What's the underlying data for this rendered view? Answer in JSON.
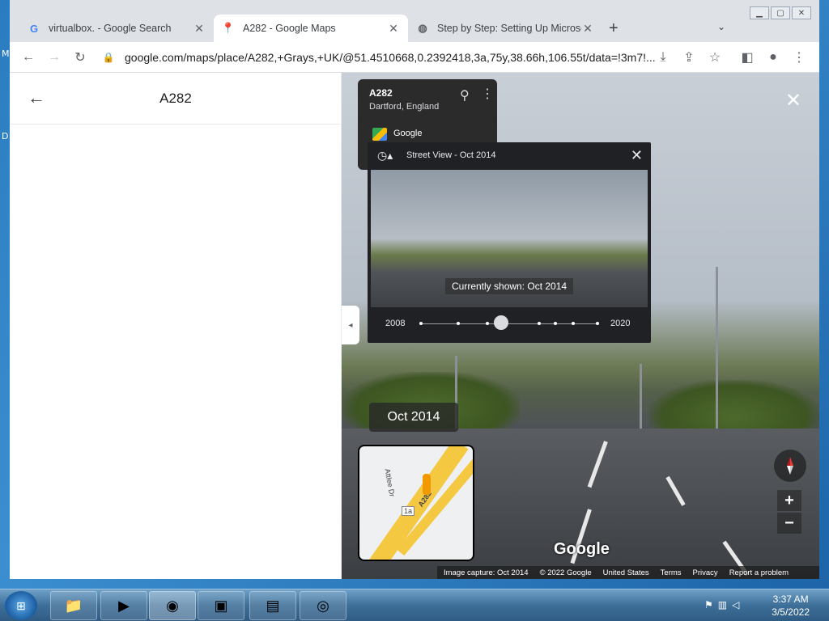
{
  "desktop": {
    "left_letters": [
      "M",
      "D"
    ]
  },
  "browser": {
    "tabs": [
      {
        "title": "virtualbox. - Google Search",
        "icon": "google-g-icon",
        "active": false
      },
      {
        "title": "A282 - Google Maps",
        "icon": "maps-pin-icon",
        "active": true
      },
      {
        "title": "Step by Step: Setting Up Microsoft",
        "icon": "globe-icon",
        "active": false
      }
    ],
    "new_tab_label": "+",
    "url": "google.com/maps/place/A282,+Grays,+UK/@51.4510668,0.2392418,3a,75y,38.66h,106.55t/data=!3m7!..."
  },
  "side_panel": {
    "title": "A282"
  },
  "info_card": {
    "title": "A282",
    "subtitle": "Dartford, England",
    "brand": "Google"
  },
  "timeline": {
    "header": "Street View - Oct 2014",
    "currently_shown": "Currently shown: Oct 2014",
    "start_year": "2008",
    "end_year": "2020",
    "selected_fraction": 0.35
  },
  "streetview": {
    "date_badge": "Oct 2014",
    "logo": "Google",
    "minimap_labels": [
      "Attlee Dr",
      "A282",
      "1a"
    ],
    "zoom_in": "+",
    "zoom_out": "−",
    "footer": {
      "capture": "Image capture: Oct 2014",
      "copyright": "© 2022 Google",
      "region": "United States",
      "terms": "Terms",
      "privacy": "Privacy",
      "report": "Report a problem"
    }
  },
  "taskbar": {
    "time": "3:37 AM",
    "date": "3/5/2022"
  },
  "colors": {
    "chrome_bg": "#dee1e6",
    "taskbar": "#3e6f98",
    "panel_dark": "#202124"
  }
}
